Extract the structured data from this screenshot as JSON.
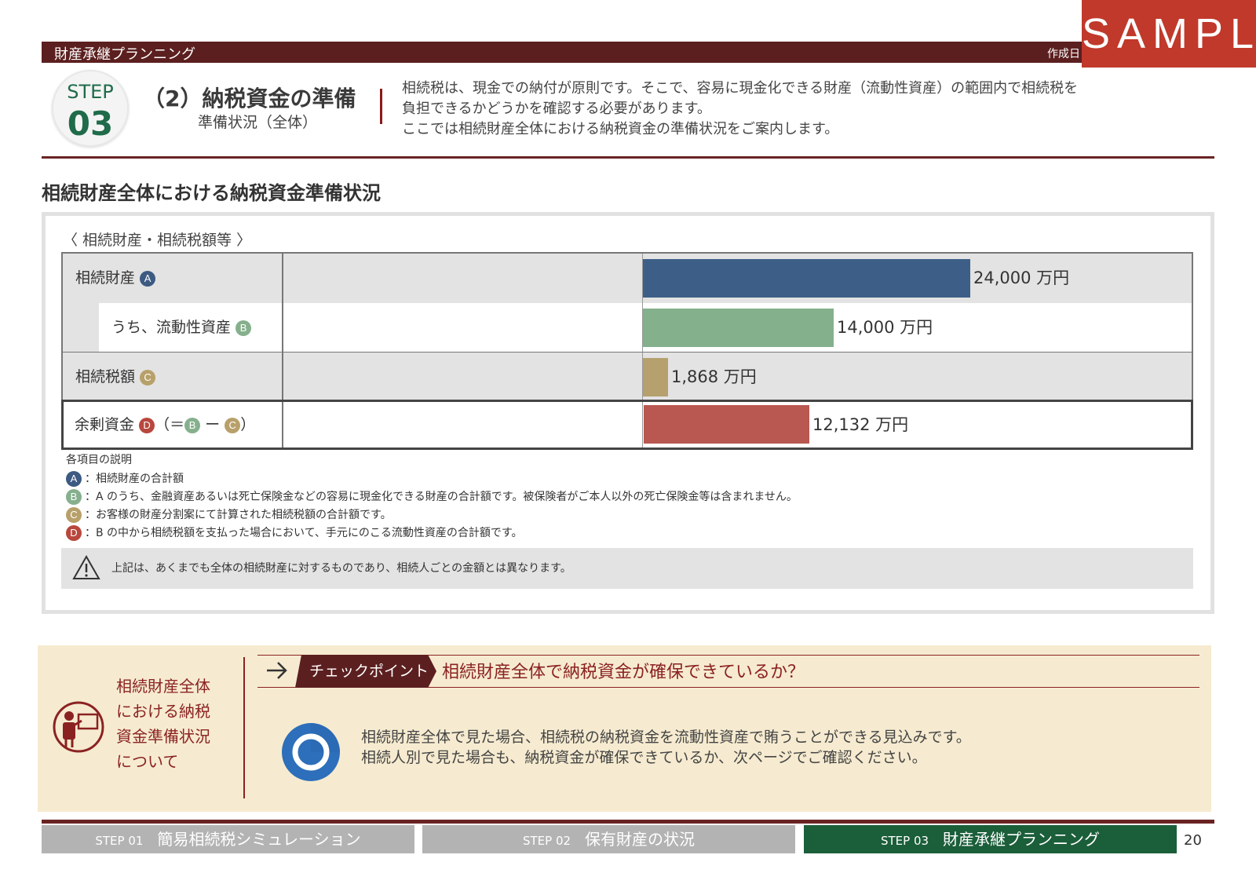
{
  "sample_label": "SAMPLE",
  "header": {
    "title": "財産承継プランニング",
    "date_label": "作成日"
  },
  "step": {
    "label": "STEP",
    "number": "03"
  },
  "section": {
    "title": "（2）納税資金の準備",
    "subtitle": "準備状況（全体）",
    "intro": [
      "相続税は、現金での納付が原則です。そこで、容易に現金化できる財産（流動性資産）の範囲内で相続税を",
      "負担できるかどうかを確認する必要があります。",
      "ここでは相続財産全体における納税資金の準備状況をご案内します。"
    ]
  },
  "heading": "相続財産全体における納税資金準備状況",
  "panel_caption": "〈 相続財産・相続税額等 〉",
  "rows": [
    {
      "label": "相続財産",
      "badge": "A"
    },
    {
      "label": "うち、流動性資産",
      "badge": "B"
    },
    {
      "label": "相続税額",
      "badge": "C"
    },
    {
      "label": "余剰資金",
      "badge": "D",
      "formula_open": "（＝",
      "formula_minus": "ー",
      "formula_close": "）",
      "formula_b": "B",
      "formula_c": "C"
    }
  ],
  "chart_data": {
    "type": "bar",
    "categories": [
      "相続財産 A",
      "うち、流動性資産 B",
      "相続税額 C",
      "余剰資金 D"
    ],
    "values": [
      24000,
      14000,
      1868,
      12132
    ],
    "value_labels": [
      "24,000 万円",
      "14,000 万円",
      "1,868 万円",
      "12,132 万円"
    ],
    "unit": "万円",
    "colors": [
      "#3d5f87",
      "#84b08c",
      "#b5a06e",
      "#b85850"
    ],
    "xlim": [
      0,
      24000
    ]
  },
  "notes": {
    "head": "各項目の説明",
    "items": [
      {
        "badge": "A",
        "text": "：相続財産の合計額"
      },
      {
        "badge": "B",
        "text": "：A のうち、金融資産あるいは死亡保険金などの容易に現金化できる財産の合計額です。被保険者がご本人以外の死亡保険金等は含まれません。"
      },
      {
        "badge": "C",
        "text": "：お客様の財産分割案にて計算された相続税額の合計額です。"
      },
      {
        "badge": "D",
        "text": "：B の中から相続税額を支払った場合において、手元にのこる流動性資産の合計額です。"
      }
    ]
  },
  "warning": "上記は、あくまでも全体の相続財産に対するものであり、相続人ごとの金額とは異なります。",
  "checkpoint": {
    "topic": [
      "相続財産全体",
      "における納税",
      "資金準備状況",
      "について"
    ],
    "tag": "チェックポイント",
    "question": "相続財産全体で納税資金が確保できているか？",
    "result": [
      "相続財産全体で見た場合、相続税の納税資金を流動性資産で賄うことができる見込みです。",
      "相続人別で見た場合も、納税資金が確保できているか、次ページでご確認ください。"
    ]
  },
  "nav": [
    {
      "step": "STEP 01",
      "label": "簡易相続税シミュレーション"
    },
    {
      "step": "STEP 02",
      "label": "保有財産の状況"
    },
    {
      "step": "STEP 03",
      "label": "財産承継プランニング"
    }
  ],
  "page_number": "20"
}
